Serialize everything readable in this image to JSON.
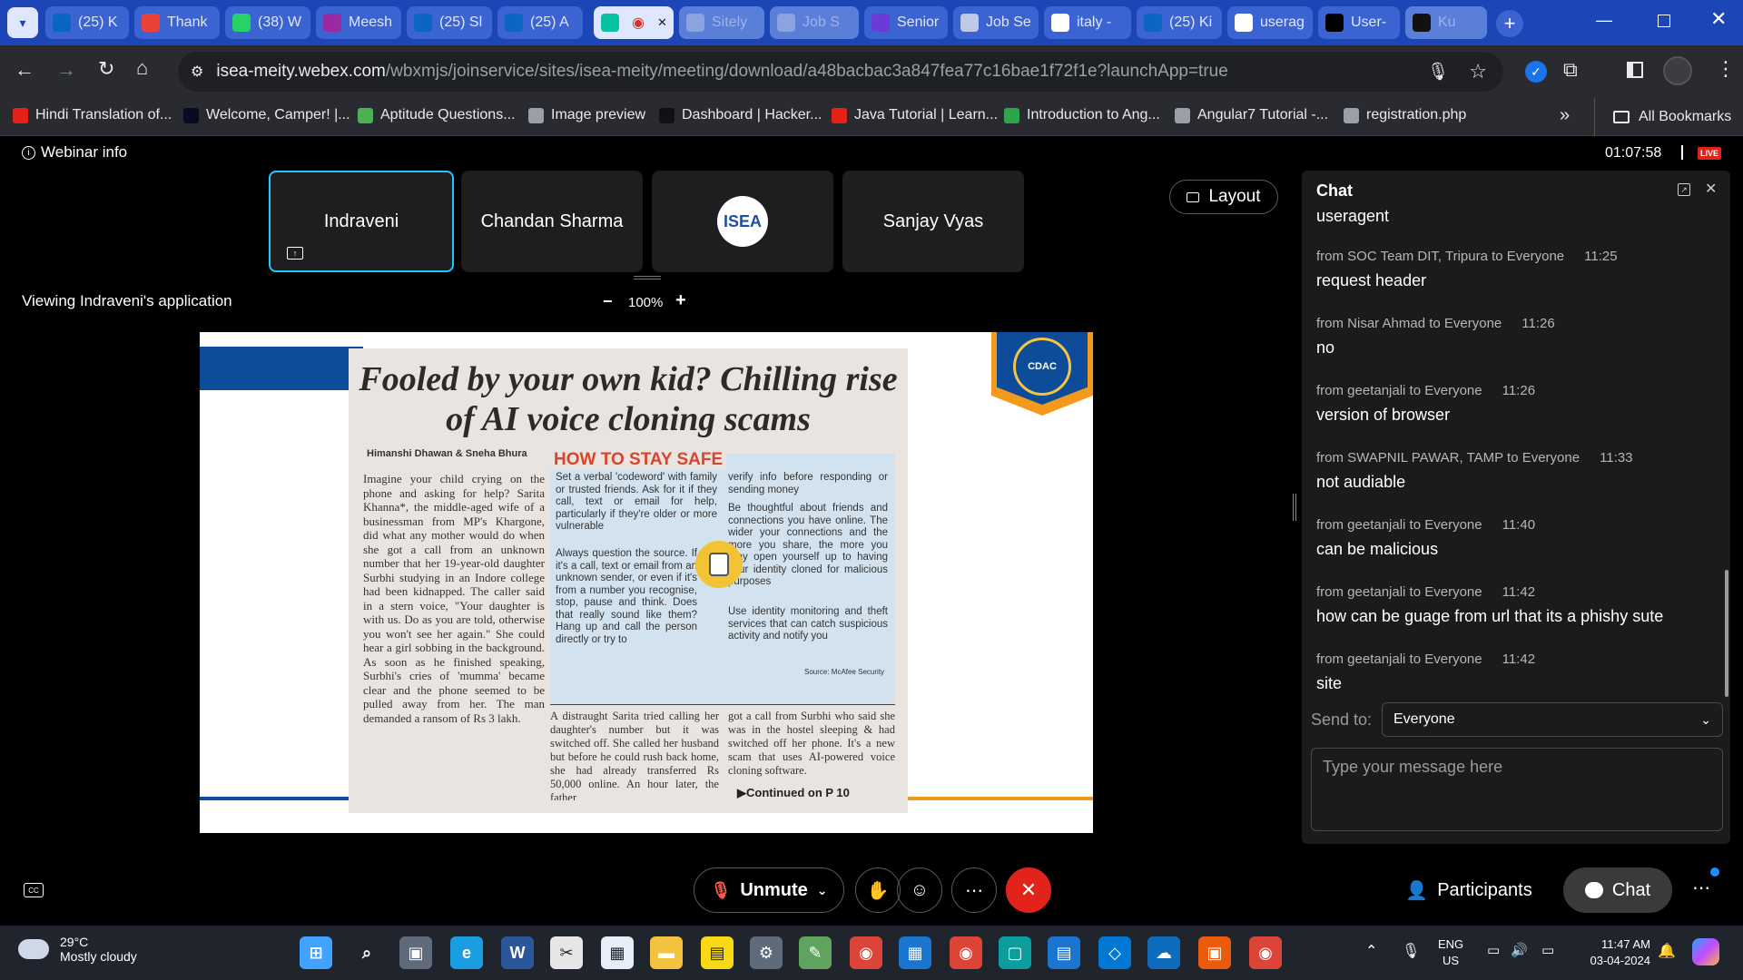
{
  "browser": {
    "tabs": [
      {
        "label": "(25) K",
        "icon": "linkedin-icon",
        "color": "#0a66c2"
      },
      {
        "label": "Thank",
        "icon": "gmail-icon",
        "color": "#ea4335"
      },
      {
        "label": "(38) W",
        "icon": "whatsapp-icon",
        "color": "#25d366"
      },
      {
        "label": "Meesh",
        "icon": "meesho-icon",
        "color": "#9b2aa1"
      },
      {
        "label": "(25) Sl",
        "icon": "linkedin-icon",
        "color": "#0a66c2"
      },
      {
        "label": "(25) A",
        "icon": "linkedin-icon",
        "color": "#0a66c2"
      },
      {
        "label": "",
        "icon": "webex-icon",
        "color": "#07c1a0"
      },
      {
        "label": "Sitely",
        "icon": "globe-icon",
        "color": "#8aa4e0"
      },
      {
        "label": "Job S",
        "icon": "globe-icon",
        "color": "#8aa4e0"
      },
      {
        "label": "Senior",
        "icon": "ppt-icon",
        "color": "#6a3bd8"
      },
      {
        "label": "Job Se",
        "icon": "globe-icon",
        "color": "#c0c8e8"
      },
      {
        "label": "italy -",
        "icon": "google-icon",
        "color": "#ffffff"
      },
      {
        "label": "(25) Ki",
        "icon": "linkedin-icon",
        "color": "#0a66c2"
      },
      {
        "label": "userag",
        "icon": "google-icon",
        "color": "#ffffff"
      },
      {
        "label": "User-",
        "icon": "medium-icon",
        "color": "#000000"
      },
      {
        "label": "Ku",
        "icon": "github-icon",
        "color": "#111111"
      }
    ],
    "address": {
      "host": "isea-meity.webex.com",
      "path": "/wbxmjs/joinservice/sites/isea-meity/meeting/download/a48bacbac3a847fea77c16bae1f72f1e?launchApp=true"
    },
    "bookmarks": [
      {
        "label": "Hindi Translation of...",
        "color": "#e62117"
      },
      {
        "label": "Welcome, Camper! |...",
        "color": "#0a0a23"
      },
      {
        "label": "Aptitude Questions...",
        "color": "#4caf50"
      },
      {
        "label": "Image preview",
        "color": "#9aa0a6"
      },
      {
        "label": "Dashboard | Hacker...",
        "color": "#111111"
      },
      {
        "label": "Java Tutorial | Learn...",
        "color": "#e62117"
      },
      {
        "label": "Introduction to Ang...",
        "color": "#2ea44f"
      },
      {
        "label": "Angular7 Tutorial -...",
        "color": "#9aa0a6"
      },
      {
        "label": "registration.php",
        "color": "#9aa0a6"
      }
    ],
    "all_bookmarks": "All Bookmarks"
  },
  "meeting": {
    "webinar_info": "Webinar info",
    "timer": "01:07:58",
    "live": "LIVE",
    "layout_label": "Layout",
    "participants_tiles": [
      "Indraveni",
      "Chandan Sharma",
      "",
      "Sanjay Vyas"
    ],
    "isea_logo_text": "ISEA",
    "viewing_text": "Viewing Indraveni's application",
    "zoom": "100%",
    "zoom_minus": "−",
    "zoom_plus": "+"
  },
  "newspaper": {
    "headline": "Fooled by your own kid? Chilling rise of AI voice cloning scams",
    "byline": "Himanshi Dhawan & Sneha Bhura",
    "box_title": "HOW TO STAY SAFE",
    "col1": "Imagine your child crying on the phone and asking for help? Sarita Khanna*, the middle-aged wife of a businessman from MP's Khargone, did what any mother would do when she got a call from an unknown number that her 19-year-old daughter Surbhi studying in an Indore college had been kidnapped. The caller said in a stern voice, \"Your daughter is with us. Do as you are told, otherwise you won't see her again.\" She could hear a girl sobbing in the background. As soon as he finished speaking, Surbhi's cries of 'mumma' became clear and the phone seemed to be pulled away from her. The man demanded a ransom of Rs 3 lakh.",
    "tip1": "Set a verbal 'codeword' with family or trusted friends. Ask for it if they call, text or email for help, particularly if they're older or more vulnerable",
    "tip2": "Always question the source. If it's a call, text or email from an unknown sender, or even if it's from a number you recognise, stop, pause and think. Does that really sound like them? Hang up and call the person directly or try to",
    "tip3": "verify info before responding or sending money",
    "tip4": "Be thoughtful about friends and connections you have online. The wider your connections and the more you share, the more you may open yourself up to having your identity cloned for malicious purposes",
    "tip5": "Use identity monitoring and theft services that can catch suspicious activity and notify you",
    "source": "Source: McAfee Security",
    "col2": "A distraught Sarita tried calling her daughter's number but it was switched off. She called her husband but before he could rush back home, she had already transferred Rs 50,000 online. An hour later, the father",
    "col3": "got a call from Surbhi who said she was in the hostel sleeping & had switched off her phone. It's a new scam that uses AI-powered voice cloning software.",
    "continued": "Continued on P 10",
    "cdac_text": "CDAC"
  },
  "chat": {
    "title": "Chat",
    "first_line": "useragent",
    "messages": [
      {
        "from": "from SOC Team DIT, Tripura to Everyone",
        "time": "11:25",
        "text": "request header"
      },
      {
        "from": "from Nisar Ahmad to Everyone",
        "time": "11:26",
        "text": "no"
      },
      {
        "from": "from geetanjali to Everyone",
        "time": "11:26",
        "text": "version of browser"
      },
      {
        "from": "from SWAPNIL PAWAR, TAMP to Everyone",
        "time": "11:33",
        "text": "not audiable"
      },
      {
        "from": "from geetanjali to Everyone",
        "time": "11:40",
        "text": "can be malicious"
      },
      {
        "from": "from geetanjali to Everyone",
        "time": "11:42",
        "text": "how can be guage from url that its a phishy sute"
      },
      {
        "from": "from geetanjali to Everyone",
        "time": "11:42",
        "text": "site"
      }
    ],
    "send_to_label": "Send to:",
    "send_to_value": "Everyone",
    "input_placeholder": "Type your message here"
  },
  "controls": {
    "unmute": "Unmute",
    "participants": "Participants",
    "chat": "Chat"
  },
  "taskbar": {
    "weather_temp": "29°C",
    "weather_desc": "Mostly cloudy",
    "lang1": "ENG",
    "lang2": "US",
    "time": "11:47 AM",
    "date": "03-04-2024"
  }
}
